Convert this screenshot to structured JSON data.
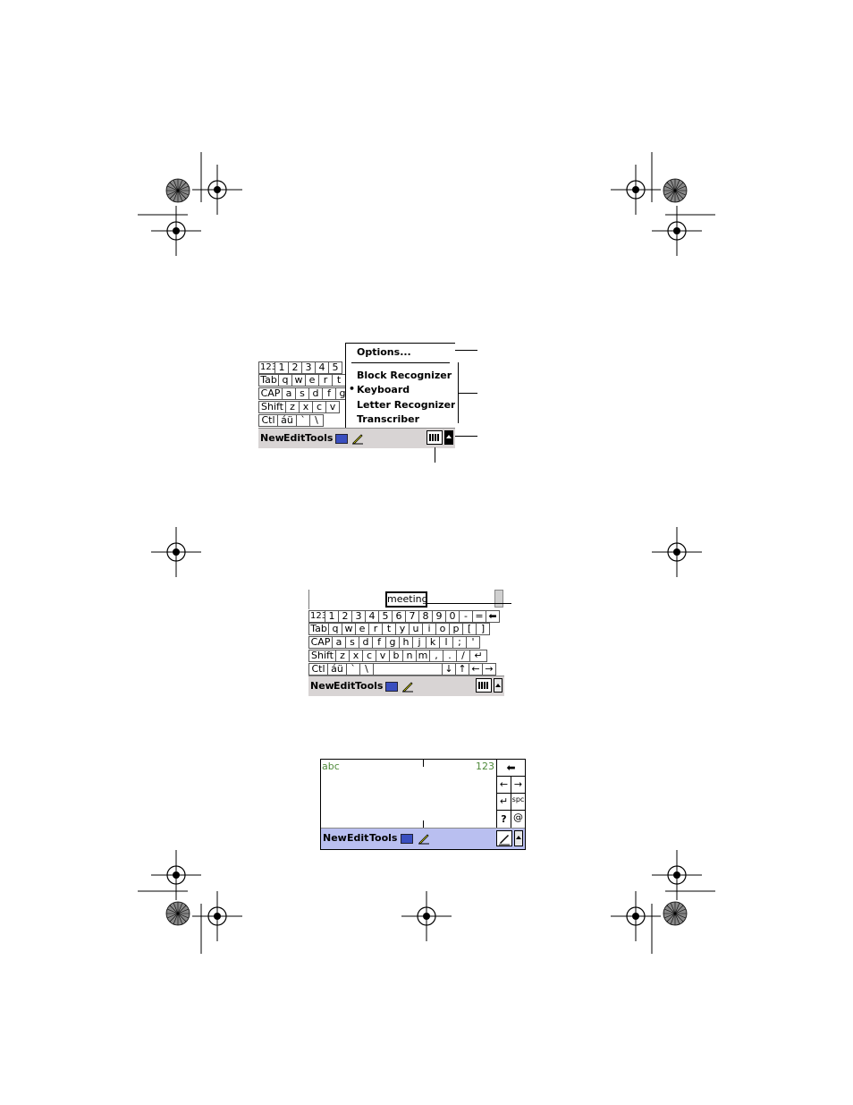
{
  "figure1": {
    "keyboard_rows": [
      [
        "123",
        "1",
        "2",
        "3",
        "4",
        "5"
      ],
      [
        "Tab",
        "q",
        "w",
        "e",
        "r",
        "t"
      ],
      [
        "CAP",
        "a",
        "s",
        "d",
        "f",
        "g"
      ],
      [
        "Shift",
        "z",
        "x",
        "c",
        "v"
      ],
      [
        "Ctl",
        "áü",
        "`",
        "\\"
      ]
    ],
    "menubar": {
      "new": "New",
      "edit": "Edit",
      "tools": "Tools"
    },
    "popup": {
      "options": "Options...",
      "block_recognizer": "Block Recognizer",
      "keyboard": "Keyboard",
      "letter_recognizer": "Letter Recognizer",
      "transcriber": "Transcriber",
      "selected_bullet": "•"
    }
  },
  "figure2": {
    "suggestion": "meeting",
    "keyboard_rows": [
      [
        "123",
        "1",
        "2",
        "3",
        "4",
        "5",
        "6",
        "7",
        "8",
        "9",
        "0",
        "-",
        "=",
        "⬅"
      ],
      [
        "Tab",
        "q",
        "w",
        "e",
        "r",
        "t",
        "y",
        "u",
        "i",
        "o",
        "p",
        "[",
        "]"
      ],
      [
        "CAP",
        "a",
        "s",
        "d",
        "f",
        "g",
        "h",
        "j",
        "k",
        "l",
        ";",
        "'"
      ],
      [
        "Shift",
        "z",
        "x",
        "c",
        "v",
        "b",
        "n",
        "m",
        ",",
        ".",
        "/",
        "↵"
      ],
      [
        "Ctl",
        "áü",
        "`",
        "\\",
        " ",
        "↓",
        "↑",
        "←",
        "→"
      ]
    ],
    "menubar": {
      "new": "New",
      "edit": "Edit",
      "tools": "Tools"
    }
  },
  "figure3": {
    "left_label": "abc",
    "right_label": "123",
    "side_keys": [
      "⬅",
      "←",
      "→",
      "↵",
      "spc",
      "?",
      "@"
    ],
    "menubar": {
      "new": "New",
      "edit": "Edit",
      "tools": "Tools"
    }
  },
  "colors": {
    "menubar_gray": "#d8d4d4",
    "menubar_blue": "#b9bff0",
    "recognizer_label_green": "#4f8a3a"
  }
}
